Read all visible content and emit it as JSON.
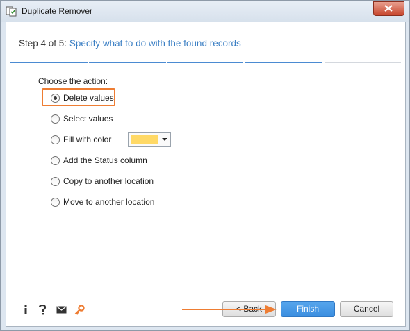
{
  "window": {
    "title": "Duplicate Remover"
  },
  "header": {
    "step": "Step 4 of 5:",
    "description": "Specify what to do with the found records",
    "progress_current": 4,
    "progress_total": 5
  },
  "form": {
    "label": "Choose the action:",
    "options": [
      {
        "label": "Delete values",
        "checked": true
      },
      {
        "label": "Select values",
        "checked": false
      },
      {
        "label": "Fill with color",
        "checked": false
      },
      {
        "label": "Add the Status column",
        "checked": false
      },
      {
        "label": "Copy to another location",
        "checked": false
      },
      {
        "label": "Move to another location",
        "checked": false
      }
    ],
    "fill_color": "#ffd966"
  },
  "footer": {
    "icons": [
      "info-icon",
      "help-icon",
      "mail-icon",
      "key-icon"
    ],
    "back_label": "< Back",
    "finish_label": "Finish",
    "cancel_label": "Cancel"
  },
  "colors": {
    "accent": "#3b8ee0",
    "highlight": "#ee7d33",
    "step_desc": "#3b7fc4"
  }
}
